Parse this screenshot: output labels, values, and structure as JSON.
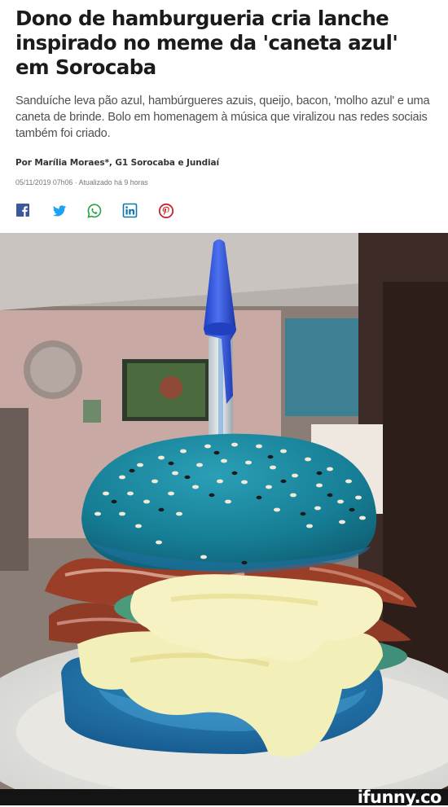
{
  "article": {
    "headline": "Dono de hamburgueria cria lanche inspirado no meme da 'caneta azul' em Sorocaba",
    "subtitle": "Sanduíche leva pão azul, hambúrgueres azuis, queijo, bacon, 'molho azul' e uma caneta de brinde. Bolo em homenagem à música que viralizou nas redes sociais também foi criado.",
    "byline": "Por Marília Moraes*, G1 Sorocaba e Jundiaí",
    "dates": "05/11/2019 07h06 · Atualizado há 9 horas"
  },
  "share": [
    {
      "icon": "facebook-icon",
      "color": "#3b5998"
    },
    {
      "icon": "twitter-icon",
      "color": "#1da1f2"
    },
    {
      "icon": "whatsapp-icon",
      "color": "#25a244"
    },
    {
      "icon": "linkedin-icon",
      "color": "#0e76a8"
    },
    {
      "icon": "pinterest-icon",
      "color": "#c8232c"
    }
  ],
  "photo": {
    "subject": "blue-burger-with-pen-photo"
  },
  "watermark": {
    "text": "ifunny.co"
  },
  "colors": {
    "headline": "#1b1b1b",
    "subtitle": "#4f4f4f",
    "bun_blue": "#1a8fa8",
    "cheese": "#f3efb8",
    "bacon": "#8f3b26"
  }
}
